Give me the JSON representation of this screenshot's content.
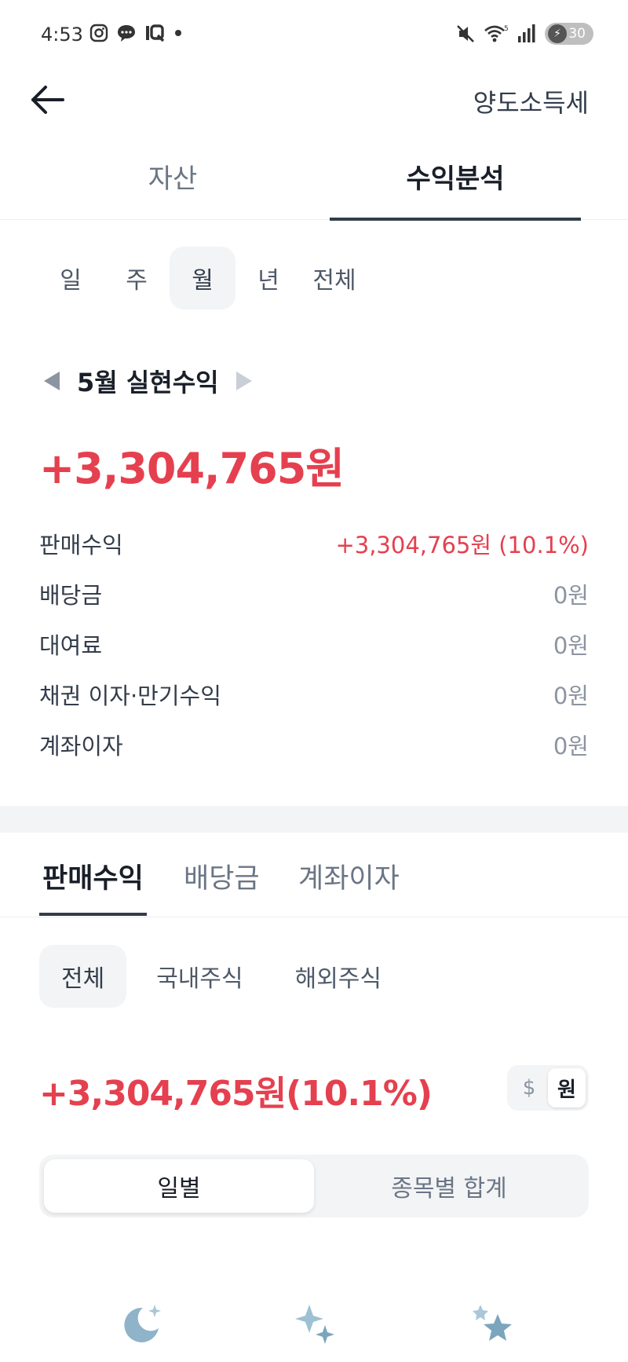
{
  "status_bar": {
    "time": "4:53",
    "battery": "30",
    "icons": [
      "instagram-icon",
      "chat-bubble-icon",
      "1q-app-icon",
      "dot-icon",
      "mute-icon",
      "wifi-icon",
      "signal-icon",
      "battery-icon"
    ]
  },
  "header": {
    "title": "양도소득세",
    "back_icon": "arrow-left-icon"
  },
  "main_tabs": [
    {
      "label": "자산",
      "active": false
    },
    {
      "label": "수익분석",
      "active": true
    }
  ],
  "period_tabs": [
    {
      "label": "일",
      "active": false
    },
    {
      "label": "주",
      "active": false
    },
    {
      "label": "월",
      "active": true
    },
    {
      "label": "년",
      "active": false
    },
    {
      "label": "전체",
      "active": false
    }
  ],
  "period_nav": {
    "label": "5월 실현수익"
  },
  "total": {
    "amount": "+3,304,765원"
  },
  "breakdown": [
    {
      "label": "판매수익",
      "value": "+3,304,765원 (10.1%)",
      "positive": true
    },
    {
      "label": "배당금",
      "value": "0원",
      "positive": false
    },
    {
      "label": "대여료",
      "value": "0원",
      "positive": false
    },
    {
      "label": "채권 이자·만기수익",
      "value": "0원",
      "positive": false
    },
    {
      "label": "계좌이자",
      "value": "0원",
      "positive": false
    }
  ],
  "sub_tabs": [
    {
      "label": "판매수익",
      "active": true
    },
    {
      "label": "배당금",
      "active": false
    },
    {
      "label": "계좌이자",
      "active": false
    }
  ],
  "market_filters": [
    {
      "label": "전체",
      "active": true
    },
    {
      "label": "국내주식",
      "active": false
    },
    {
      "label": "해외주식",
      "active": false
    }
  ],
  "sale_summary": {
    "amount": "+3,304,765원(10.1%)"
  },
  "currency_toggle": {
    "usd": "$",
    "krw": "원",
    "selected": "krw"
  },
  "view_segment": [
    {
      "label": "일별",
      "active": true
    },
    {
      "label": "종목별 합계",
      "active": false
    }
  ],
  "bottom_decorations": [
    "moon-sparkle-icon",
    "sparkles-icon",
    "stars-icon"
  ],
  "colors": {
    "positive": "#e5404f",
    "text_primary": "#191f28",
    "text_secondary": "#8b95a1",
    "chip_bg": "#f2f4f6",
    "deco": "#8fb3c9"
  }
}
